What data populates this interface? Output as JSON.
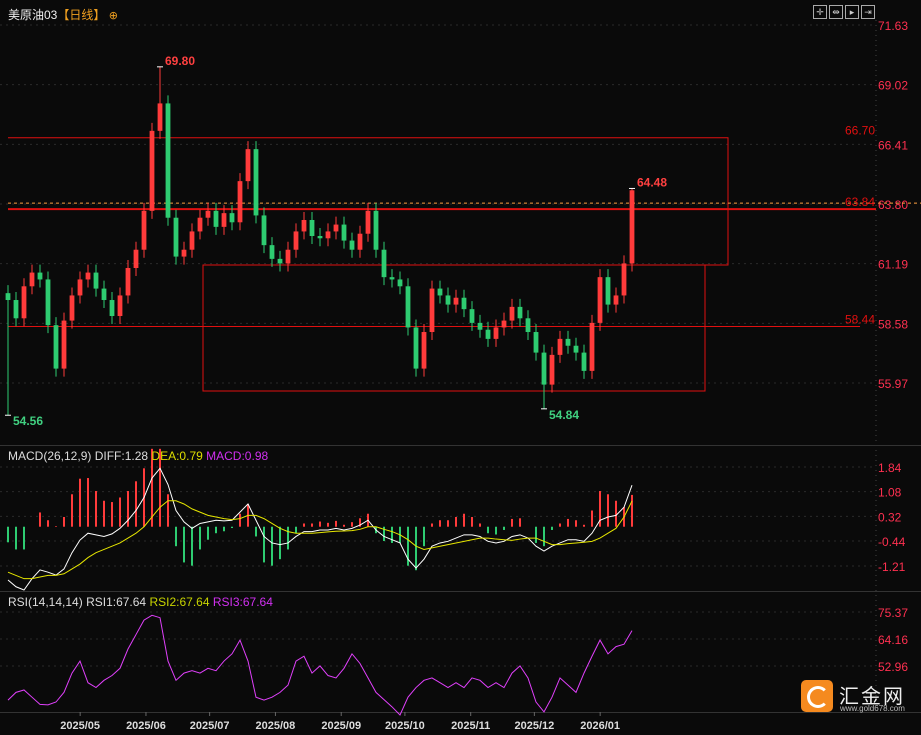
{
  "header": {
    "symbol": "美原油03",
    "period": "【日线】",
    "add_icon": "circle-plus-icon",
    "toolbar_icons": [
      "crosshair-icon",
      "range-icon",
      "play-icon",
      "fit-icon"
    ]
  },
  "macd_header": {
    "name": "MACD(26,12,9)",
    "diff": "DIFF:1.28",
    "dea": "DEA:0.79",
    "macd": "MACD:0.98"
  },
  "rsi_header": {
    "name": "RSI(14,14,14)",
    "rsi1": "RSI1:67.64",
    "rsi2": "RSI2:67.64",
    "rsi3": "RSI3:67.64"
  },
  "logo": {
    "name": "汇金网",
    "url": "www.gold678.com"
  },
  "colors": {
    "up": "#ff3b3b",
    "down": "#2ecc71",
    "diff": "#ffffff",
    "dea": "#e6e600",
    "rsi": "#e040fb",
    "axis": "#ff3050",
    "level": "#e01010",
    "current": "#ffa040"
  },
  "chart_data": [
    {
      "type": "candlestick",
      "x_range": [
        "2025-03-28",
        "2026-01-16"
      ],
      "y_ticks": [
        "71.63",
        "69.02",
        "66.41",
        "63.80",
        "61.19",
        "58.58",
        "55.97"
      ],
      "ylim": [
        55.97,
        71.63
      ],
      "closes": [
        59.6,
        58.8,
        60.2,
        60.8,
        60.5,
        58.5,
        56.6,
        58.7,
        59.8,
        60.5,
        60.8,
        60.1,
        59.6,
        58.9,
        59.8,
        61.0,
        61.8,
        63.5,
        67.0,
        68.2,
        63.2,
        61.5,
        61.8,
        62.6,
        63.2,
        63.5,
        62.8,
        63.4,
        63.0,
        64.8,
        66.2,
        63.3,
        62.0,
        61.4,
        61.2,
        61.8,
        62.6,
        63.1,
        62.4,
        62.3,
        62.6,
        62.9,
        62.2,
        61.8,
        62.5,
        63.5,
        61.8,
        60.6,
        60.5,
        60.2,
        58.4,
        56.6,
        58.2,
        60.1,
        59.8,
        59.4,
        59.7,
        59.2,
        58.6,
        58.3,
        57.9,
        58.4,
        58.7,
        59.3,
        58.8,
        58.2,
        57.3,
        55.9,
        57.2,
        57.9,
        57.6,
        57.3,
        56.5,
        58.6,
        60.6,
        59.4,
        59.8,
        61.2,
        64.4
      ],
      "annotations": [
        {
          "label": "69.80",
          "value": 69.8,
          "kind": "high",
          "index": 19
        },
        {
          "label": "54.56",
          "value": 54.56,
          "kind": "low",
          "index": 0
        },
        {
          "label": "54.84",
          "value": 54.84,
          "kind": "low",
          "index": 67
        },
        {
          "label": "64.48",
          "value": 64.48,
          "kind": "high",
          "index": 78
        }
      ],
      "levels": [
        {
          "label": "66.70",
          "value": 66.7
        },
        {
          "label": "63.84",
          "value": 63.84
        },
        {
          "label": "58.44",
          "value": 58.44
        }
      ],
      "current_price": 63.84,
      "x_ticks": [
        {
          "label": "2025/05",
          "date": "2025-05-01"
        },
        {
          "label": "2025/06",
          "date": "2025-06-01"
        },
        {
          "label": "2025/07",
          "date": "2025-07-01"
        },
        {
          "label": "2025/08",
          "date": "2025-08-01"
        },
        {
          "label": "2025/09",
          "date": "2025-09-01"
        },
        {
          "label": "2025/10",
          "date": "2025-10-01"
        },
        {
          "label": "2025/11",
          "date": "2025-11-01"
        },
        {
          "label": "2025/12",
          "date": "2025-12-01"
        },
        {
          "label": "2026/01",
          "date": "2026-01-01"
        }
      ]
    },
    {
      "type": "macd",
      "y_ticks": [
        "1.84",
        "1.08",
        "0.32",
        "-0.44",
        "-1.21"
      ],
      "ylim": [
        -1.21,
        1.84
      ],
      "diff": [
        -1.64,
        -1.85,
        -1.95,
        -1.6,
        -1.33,
        -1.4,
        -1.49,
        -1.3,
        -0.8,
        -0.41,
        -0.2,
        -0.25,
        -0.3,
        -0.22,
        -0.05,
        0.2,
        0.5,
        0.9,
        1.5,
        1.8,
        1.3,
        0.5,
        0.15,
        -0.05,
        0.1,
        0.15,
        0.2,
        0.18,
        0.2,
        0.45,
        0.7,
        0.2,
        -0.3,
        -0.5,
        -0.55,
        -0.5,
        -0.3,
        -0.15,
        -0.15,
        -0.1,
        -0.1,
        -0.05,
        -0.1,
        -0.05,
        0.05,
        0.2,
        -0.1,
        -0.3,
        -0.4,
        -0.5,
        -1.0,
        -1.27,
        -1.0,
        -0.6,
        -0.5,
        -0.45,
        -0.35,
        -0.25,
        -0.25,
        -0.3,
        -0.45,
        -0.5,
        -0.45,
        -0.3,
        -0.25,
        -0.35,
        -0.6,
        -0.75,
        -0.6,
        -0.5,
        -0.4,
        -0.4,
        -0.45,
        -0.2,
        0.2,
        0.3,
        0.35,
        0.6,
        1.28
      ],
      "dea": [
        -1.4,
        -1.5,
        -1.6,
        -1.6,
        -1.55,
        -1.5,
        -1.5,
        -1.45,
        -1.3,
        -1.15,
        -0.95,
        -0.8,
        -0.7,
        -0.6,
        -0.5,
        -0.35,
        -0.2,
        0.0,
        0.3,
        0.6,
        0.8,
        0.8,
        0.7,
        0.55,
        0.45,
        0.35,
        0.3,
        0.25,
        0.22,
        0.25,
        0.35,
        0.35,
        0.25,
        0.1,
        -0.05,
        -0.15,
        -0.2,
        -0.2,
        -0.2,
        -0.18,
        -0.16,
        -0.14,
        -0.13,
        -0.12,
        -0.08,
        0.0,
        0.0,
        -0.08,
        -0.15,
        -0.25,
        -0.4,
        -0.6,
        -0.7,
        -0.65,
        -0.6,
        -0.55,
        -0.5,
        -0.45,
        -0.4,
        -0.35,
        -0.35,
        -0.38,
        -0.4,
        -0.42,
        -0.38,
        -0.35,
        -0.35,
        -0.45,
        -0.55,
        -0.55,
        -0.52,
        -0.5,
        -0.48,
        -0.45,
        -0.35,
        -0.2,
        -0.05,
        0.3,
        0.79
      ]
    },
    {
      "type": "line",
      "name": "RSI",
      "y_ticks": [
        "75.37",
        "64.16",
        "52.96"
      ],
      "ylim": [
        41.76,
        75.37
      ],
      "values": [
        38.8,
        42,
        43,
        40,
        37,
        36.8,
        38,
        42,
        50,
        55,
        46,
        44,
        47,
        49,
        52,
        60,
        66,
        72,
        74,
        73,
        55,
        47,
        50,
        51,
        50,
        52,
        51,
        55,
        58,
        63.7,
        55,
        40,
        38.8,
        40,
        42,
        45,
        55,
        57,
        50,
        53,
        49,
        48,
        52,
        58,
        54,
        48,
        42,
        39,
        36,
        32.6,
        40,
        44,
        47,
        48,
        46,
        44,
        46,
        44,
        48,
        47,
        44,
        46,
        44,
        50,
        53,
        48,
        38,
        33.9,
        40,
        48,
        45,
        42,
        50,
        57,
        63.7,
        58,
        61,
        62,
        67.64
      ]
    }
  ]
}
